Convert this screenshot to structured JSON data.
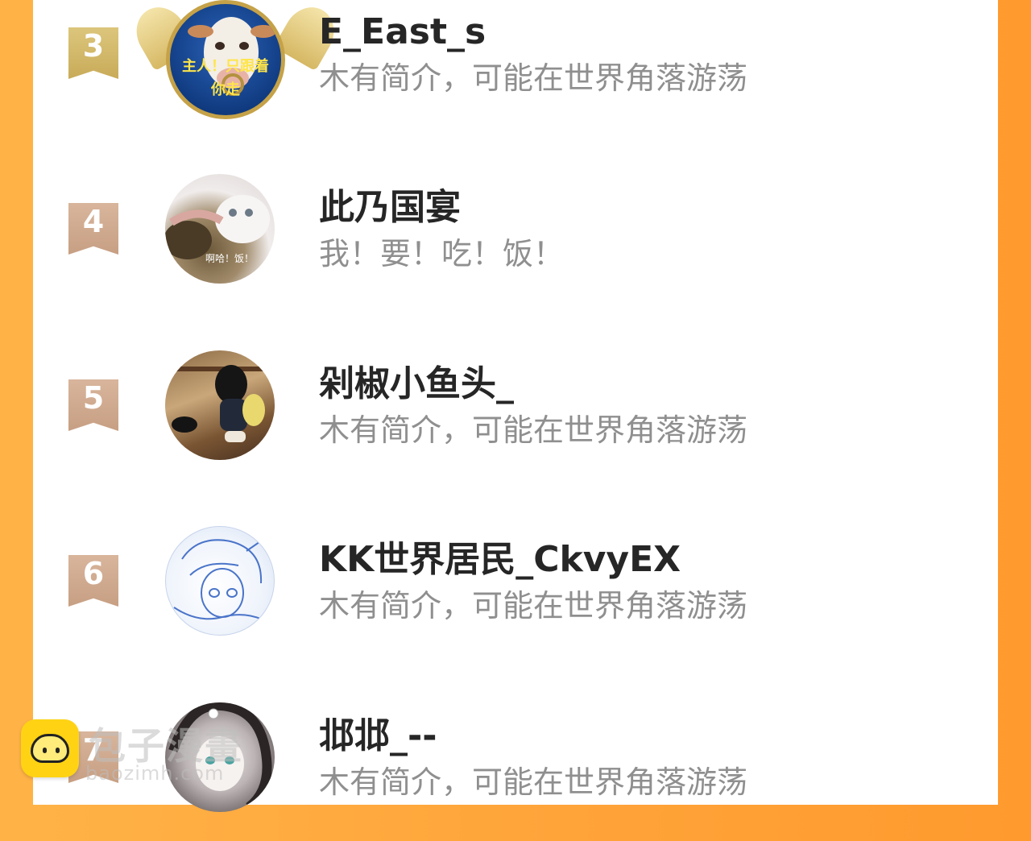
{
  "ranking_list": {
    "rows": [
      {
        "rank": "3",
        "name": "E_East_s",
        "bio": "木有简介，可能在世界角落游荡",
        "avatar_caption": "主人！只跟着你走",
        "avatar_icon": "cow-avatar-icon"
      },
      {
        "rank": "4",
        "name": "此乃国宴",
        "bio": "我！要！吃！饭！",
        "avatar_caption": "啊哈！饭！",
        "avatar_icon": "cat-avatar-icon"
      },
      {
        "rank": "5",
        "name": "剁椒小鱼头_",
        "bio": "木有简介，可能在世界角落游荡",
        "avatar_icon": "girl-with-cat-avatar-icon"
      },
      {
        "rank": "6",
        "name": "KK世界居民_CkvyEX",
        "bio": "木有简介，可能在世界角落游荡",
        "avatar_icon": "sketch-avatar-icon"
      },
      {
        "rank": "7",
        "name": "邶邶_--",
        "bio": "木有简介，可能在世界角落游荡",
        "avatar_icon": "anime-avatar-icon"
      }
    ]
  },
  "watermark": {
    "title": "包子漫畫",
    "url": "baozimh.com",
    "logo_icon": "baozi-logo-icon"
  },
  "colors": {
    "background_orange": "#ffa53a",
    "rank_gold": "#c8ab59",
    "rank_tan": "#c79f83",
    "name_text": "#262626",
    "bio_text": "#8f8f8f"
  }
}
